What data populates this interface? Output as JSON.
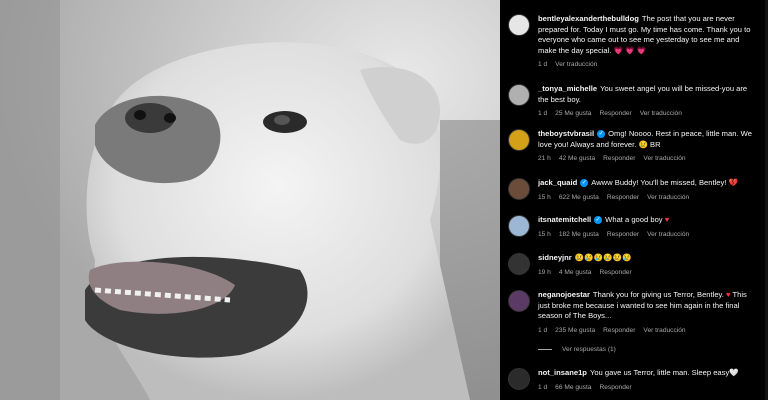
{
  "photo": {
    "alt_icon": "bulldog-photo"
  },
  "comments": [
    {
      "username": "bentleyalexanderthebulldog",
      "verified": false,
      "text": "The post that you are never prepared for. Today I must go. My time has come. Thank you to everyone who came out to see me yesterday to see me and make the day special. ",
      "emoji": "💗 💗 💗",
      "time": "1 d",
      "likes": "",
      "reply": "",
      "translate": "Ver traducción"
    },
    {
      "username": "_tonya_michelle",
      "verified": false,
      "text": "You sweet angel you will be missed-you are the best boy.",
      "emoji": "",
      "time": "1 d",
      "likes": "25 Me gusta",
      "reply": "Responder",
      "translate": "Ver traducción"
    },
    {
      "username": "theboystvbrasil",
      "verified": true,
      "text": "Omg! Noooo. Rest in peace, little man. We love you! Always and forever. ",
      "emoji": "😢 BR",
      "time": "21 h",
      "likes": "42 Me gusta",
      "reply": "Responder",
      "translate": "Ver traducción"
    },
    {
      "username": "jack_quaid",
      "verified": true,
      "text": "Awww Buddy! You'll be missed, Bentley! ",
      "emoji": "💔",
      "time": "15 h",
      "likes": "622 Me gusta",
      "reply": "Responder",
      "translate": "Ver traducción"
    },
    {
      "username": "itsnatemitchell",
      "verified": true,
      "text": "What a good boy ",
      "emoji": "♥",
      "time": "15 h",
      "likes": "182 Me gusta",
      "reply": "Responder",
      "translate": "Ver traducción"
    },
    {
      "username": "sidneyjnr",
      "verified": false,
      "text": "",
      "emoji": "😢😢😢😢😢😢",
      "time": "19 h",
      "likes": "4 Me gusta",
      "reply": "Responder",
      "translate": ""
    },
    {
      "username": "neganojoestar",
      "verified": false,
      "text": "Thank you for giving us Terror, Bentley. ",
      "emoji": "♥",
      "text2": " This just broke me because i wanted to see him again in the final season of The Boys...",
      "time": "1 d",
      "likes": "235 Me gusta",
      "reply": "Responder",
      "translate": "Ver traducción"
    },
    {
      "username": "not_insane1p",
      "verified": false,
      "text": "You gave us Terror, little man. Sleep easy",
      "emoji": "🤍",
      "time": "1 d",
      "likes": "66 Me gusta",
      "reply": "Responder",
      "translate": ""
    }
  ],
  "view_replies": "Ver respuestas (1)",
  "colors": {
    "background": "#000000",
    "text": "#f5f5f5",
    "muted": "#a8a8a8",
    "verified": "#0095f6",
    "heart": "#ff3040"
  }
}
